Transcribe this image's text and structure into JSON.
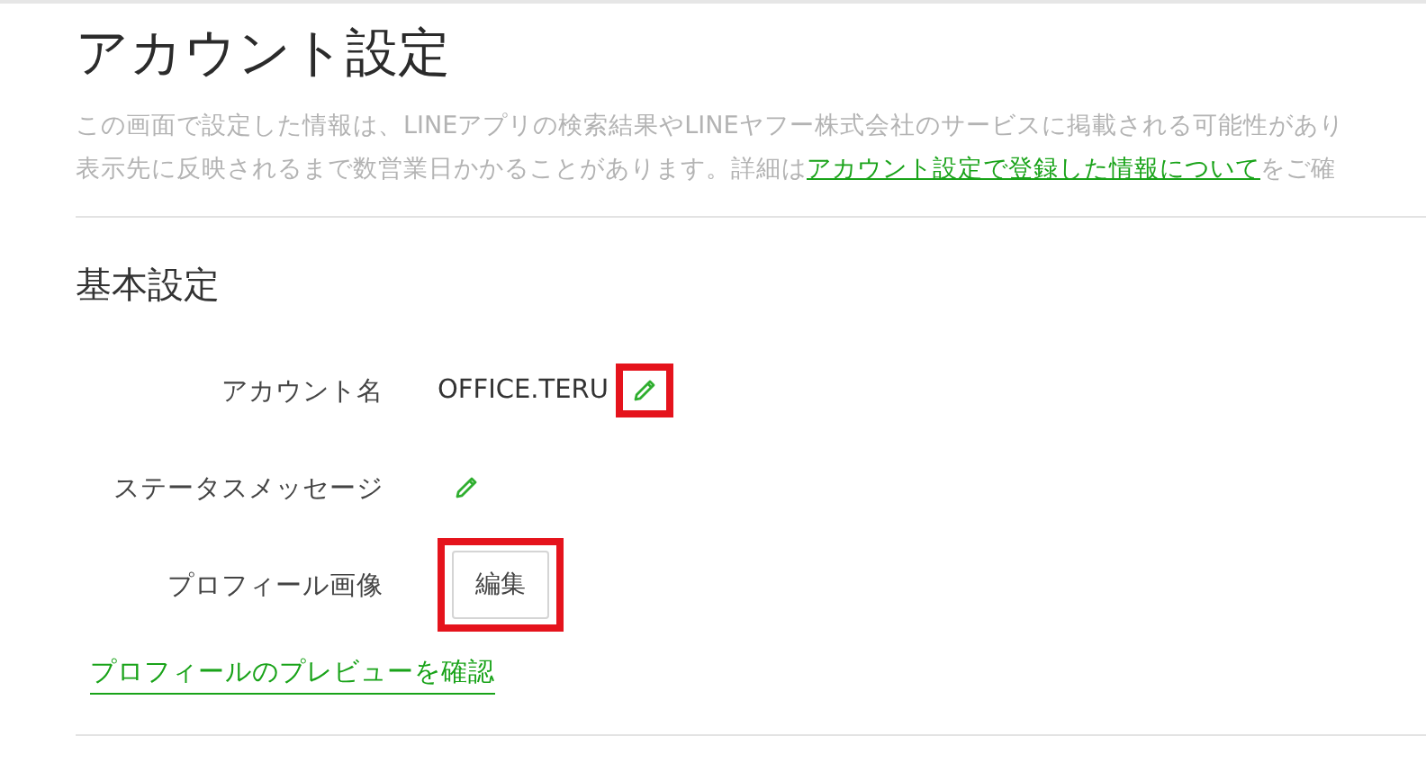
{
  "page": {
    "title": "アカウント設定",
    "description_lines": [
      {
        "text": "この画面で設定した情報は、LINEアプリの検索結果やLINEヤフー株式会社のサービスに掲載される可能性があり"
      },
      {
        "text": "表示先に反映されるまで数営業日かかることがあります。詳細は",
        "link": "アカウント設定で登録した情報について",
        "after": "をご確"
      }
    ]
  },
  "section": {
    "title": "基本設定",
    "rows": [
      {
        "label": "アカウント名",
        "value": "OFFICE.TERU",
        "kind": "edit",
        "highlighted": true
      },
      {
        "label": "ステータスメッセージ",
        "kind": "edit",
        "highlighted": false
      },
      {
        "label": "プロフィール画像",
        "kind": "button",
        "button": "編集",
        "highlighted": true
      }
    ],
    "link": "プロフィールのプレビューを確認"
  }
}
